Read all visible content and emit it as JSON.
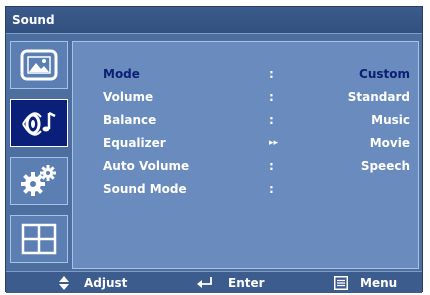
{
  "window": {
    "title": "Sound"
  },
  "sidebar": {
    "items": [
      {
        "icon": "picture-icon"
      },
      {
        "icon": "sound-icon",
        "active": true
      },
      {
        "icon": "setup-gears-icon"
      },
      {
        "icon": "layout-grid-icon"
      }
    ]
  },
  "menu": {
    "items": [
      {
        "label": "Mode",
        "separator": ":"
      },
      {
        "label": "Volume",
        "separator": ":"
      },
      {
        "label": "Balance",
        "separator": ":"
      },
      {
        "label": "Equalizer",
        "separator": "▸▸"
      },
      {
        "label": "Auto Volume",
        "separator": ":"
      },
      {
        "label": "Sound Mode",
        "separator": ":"
      }
    ],
    "selected_item": "Mode"
  },
  "mode_options": {
    "items": [
      "Custom",
      "Standard",
      "Music",
      "Movie",
      "Speech"
    ],
    "selected": "Custom"
  },
  "footer": {
    "adjust_label": "Adjust",
    "enter_label": "Enter",
    "menu_label": "Menu"
  },
  "colors": {
    "panel_bg": "#4d6fa0",
    "content_bg": "#6a8bbd",
    "selected_text": "#0b1f73",
    "active_tab": "#0a1f7a"
  }
}
